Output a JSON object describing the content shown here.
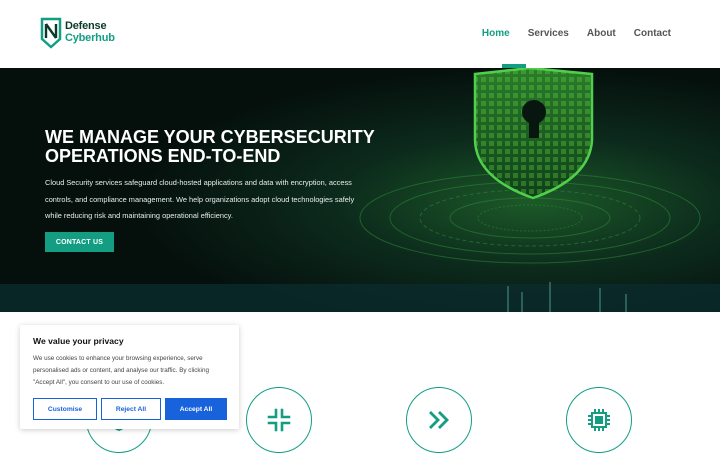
{
  "brand": {
    "line1": "Defense",
    "line2": "Cyberhub",
    "logo_icon": "shield-n-logo",
    "accent": "#139e84"
  },
  "nav": {
    "items": [
      {
        "label": "Home",
        "active": true
      },
      {
        "label": "Services",
        "active": false
      },
      {
        "label": "About",
        "active": false
      },
      {
        "label": "Contact",
        "active": false
      }
    ]
  },
  "hero": {
    "title_line1": "WE MANAGE YOUR CYBERSECURITY",
    "title_line2": "OPERATIONS END-TO-END",
    "description": "Cloud Security services safeguard cloud-hosted applications and data with encryption, access controls, and compliance management. We help organizations adopt cloud technologies safely while reducing risk and maintaining operational efficiency.",
    "cta_label": "CONTACT US",
    "image_icon": "shield-lock-icon"
  },
  "features": {
    "icons": [
      "shield-icon",
      "compress-arrows-icon",
      "double-chevron-right-icon",
      "cpu-chip-icon"
    ]
  },
  "cookie": {
    "title": "We value your privacy",
    "body": "We use cookies to enhance your browsing experience, serve personalised ads or content, and analyse our traffic. By clicking \"Accept All\", you consent to our use of cookies.",
    "customise": "Customise",
    "reject": "Reject All",
    "accept": "Accept All",
    "button_color": "#1863dc"
  }
}
